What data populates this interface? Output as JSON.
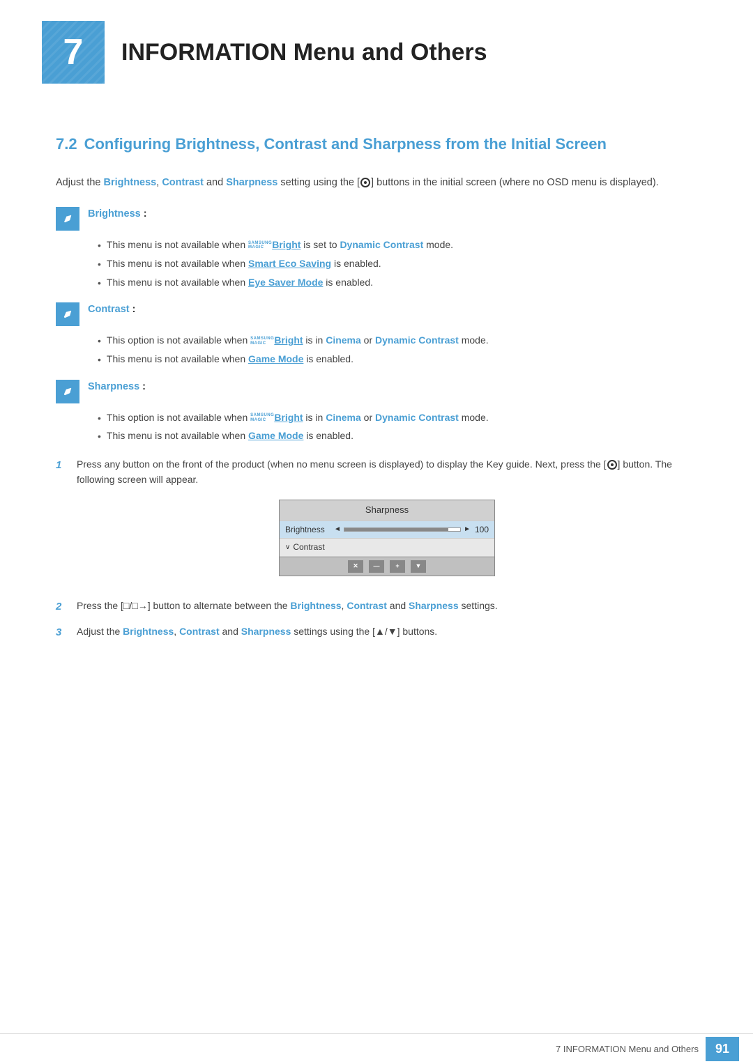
{
  "chapter": {
    "number": "7",
    "title": "INFORMATION Menu and Others"
  },
  "section": {
    "number": "7.2",
    "title": "Configuring Brightness, Contrast and Sharpness from the Initial Screen"
  },
  "intro": {
    "text_before": "Adjust the ",
    "brightness": "Brightness",
    "comma1": ", ",
    "contrast": "Contrast",
    "and": " and ",
    "sharpness": "Sharpness",
    "text_after": " setting using the [",
    "icon_label": "target",
    "text_end": "] buttons in the initial screen (where no OSD menu is displayed)."
  },
  "brightness_note": {
    "label": "Brightness",
    "colon": " :"
  },
  "brightness_bullets": [
    {
      "text_before": "This menu is not available when ",
      "samsung": "SAMSUNG",
      "magic": "MAGIC",
      "bright": "Bright",
      "text_middle": " is set to ",
      "highlight1": "Dynamic Contrast",
      "text_after": " mode."
    },
    {
      "text_before": "This menu is not available when ",
      "highlight": "Smart Eco Saving",
      "text_after": " is enabled."
    },
    {
      "text_before": "This menu is not available when ",
      "highlight": "Eye Saver Mode",
      "text_after": " is enabled."
    }
  ],
  "contrast_note": {
    "label": "Contrast",
    "colon": " :"
  },
  "contrast_bullets": [
    {
      "text_before": "This option is not available when ",
      "samsung": "SAMSUNG",
      "magic": "MAGIC",
      "bright": "Bright",
      "text_middle": " is in ",
      "highlight1": "Cinema",
      "or": " or ",
      "highlight2": "Dynamic Contrast",
      "text_after": " mode."
    },
    {
      "text_before": "This menu is not available when ",
      "highlight": "Game Mode",
      "text_after": " is enabled."
    }
  ],
  "sharpness_note": {
    "label": "Sharpness",
    "colon": " :"
  },
  "sharpness_bullets": [
    {
      "text_before": "This option is not available when ",
      "samsung": "SAMSUNG",
      "magic": "MAGIC",
      "bright": "Bright",
      "text_middle": " is in ",
      "highlight1": "Cinema",
      "or": " or ",
      "highlight2": "Dynamic Contrast",
      "text_after": " mode."
    },
    {
      "text_before": "This menu is not available when ",
      "highlight": "Game Mode",
      "text_after": " is enabled."
    }
  ],
  "steps": [
    {
      "number": "1",
      "text": "Press any button on the front of the product (when no menu screen is displayed) to display the Key guide. Next, press the [",
      "icon": "target",
      "text_end": "] button. The following screen will appear."
    },
    {
      "number": "2",
      "text_before": "Press the [",
      "icon": "□/□→",
      "text_middle": "] button to alternate between the ",
      "b1": "Brightness",
      "comma": ", ",
      "b2": "Contrast",
      "and": " and ",
      "b3": "Sharpness",
      "text_end": " settings."
    },
    {
      "number": "3",
      "text_before": "Adjust the ",
      "b1": "Brightness",
      "comma": ", ",
      "b2": "Contrast",
      "and": " and ",
      "b3": "Sharpness",
      "text_middle": " settings using the [",
      "icon": "▲/▼",
      "text_end": "] buttons."
    }
  ],
  "screen_mockup": {
    "header": "Sharpness",
    "brightness_label": "Brightness",
    "brightness_value": "100",
    "contrast_label": "Contrast",
    "buttons": [
      "✕",
      "—",
      "+",
      "▼"
    ]
  },
  "footer": {
    "text": "7 INFORMATION Menu and Others",
    "page": "91"
  }
}
